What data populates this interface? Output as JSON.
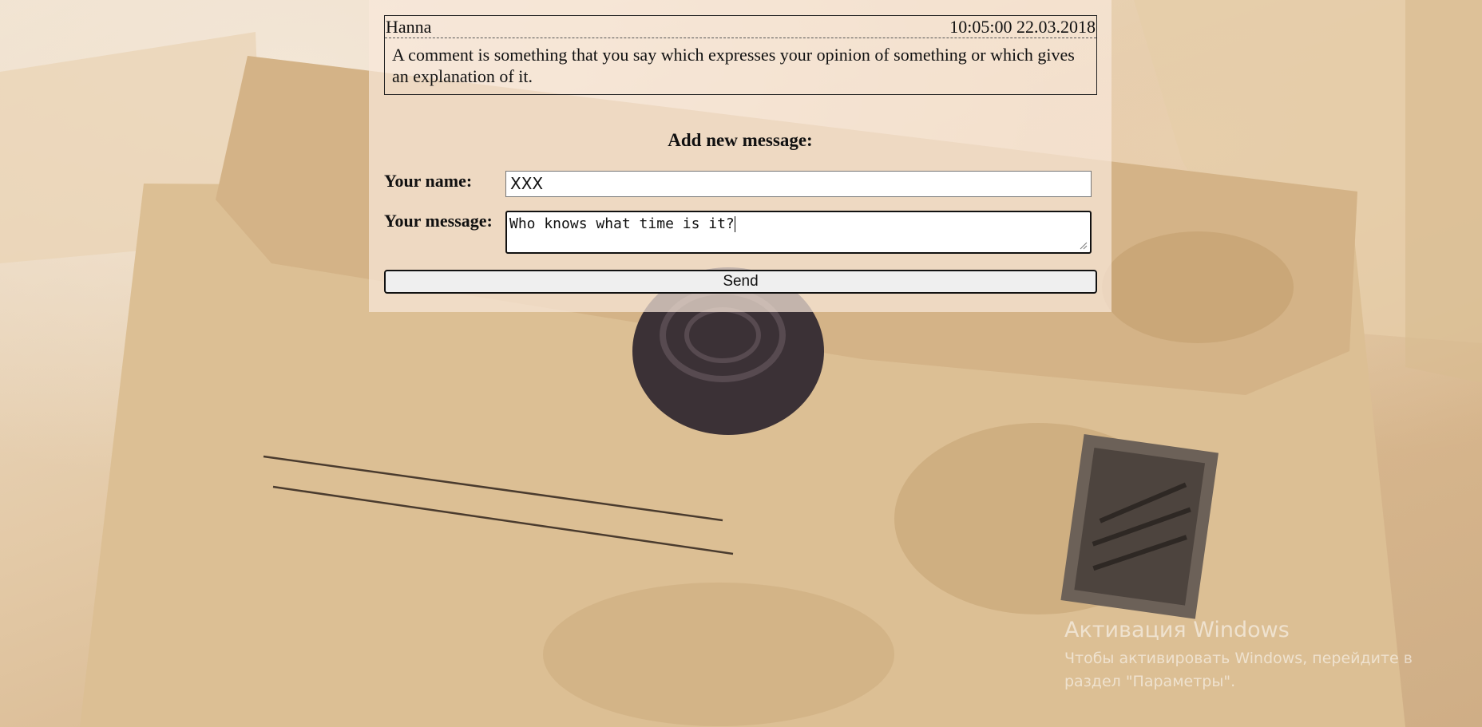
{
  "comments": [
    {
      "author": "Hanna",
      "datetime": "10:05:00 22.03.2018",
      "text": "A comment is something that you say which expresses your opinion of something or which gives an explanation of it."
    }
  ],
  "form": {
    "title": "Add new message:",
    "name_label": "Your name:",
    "name_value": "XXX",
    "message_label": "Your message:",
    "message_value": "Who knows what time is it?",
    "send_label": "Send"
  },
  "watermark": {
    "title": "Активация Windows",
    "line1": "Чтобы активировать Windows, перейдите в",
    "line2": "раздел \"Параметры\"."
  }
}
